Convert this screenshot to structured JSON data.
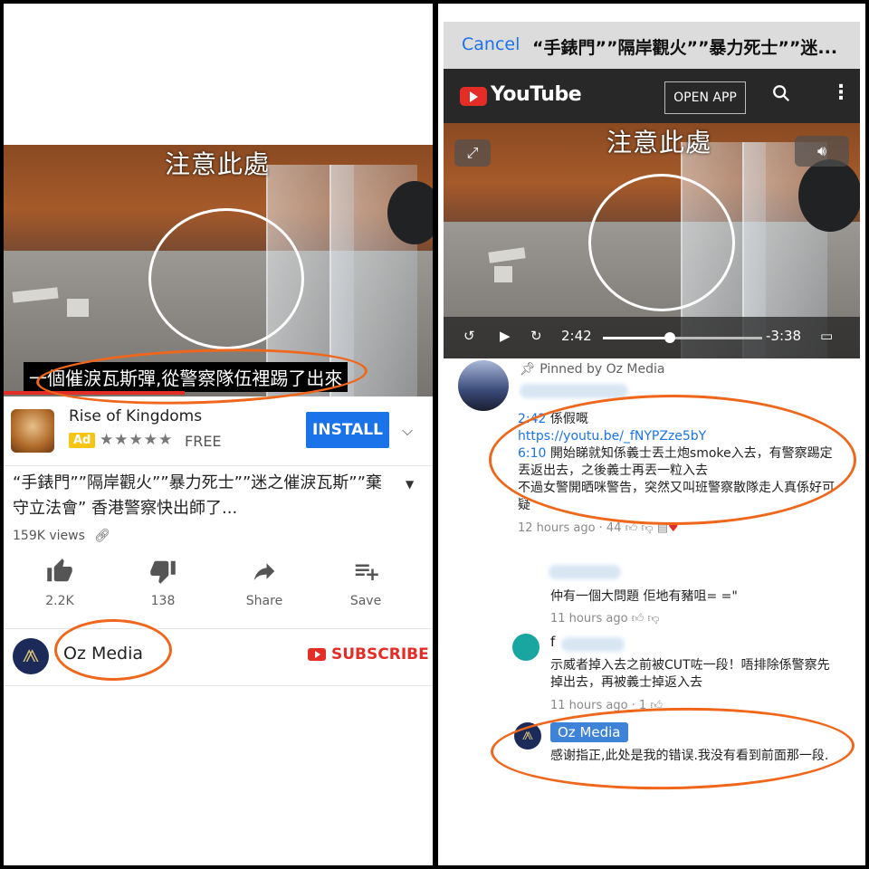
{
  "left": {
    "video": {
      "overlay_caption": "注意此處",
      "subtitle": "一個催淚瓦斯彈,從警察隊伍裡踢了出來"
    },
    "ad": {
      "app_name": "Rise of Kingdoms",
      "badge": "Ad",
      "stars": "★★★★★",
      "price": "FREE",
      "install_label": "INSTALL"
    },
    "video_title": "“手錶門””隔岸觀火””暴力死士””迷之催淚瓦斯””棄守立法會” 香港警察快出師了...",
    "views": "159K views",
    "actions": [
      {
        "icon": "thumbs-up-icon",
        "label": "2.2K"
      },
      {
        "icon": "thumbs-down-icon",
        "label": "138"
      },
      {
        "icon": "share-icon",
        "label": "Share"
      },
      {
        "icon": "playlist-add-icon",
        "label": "Save"
      }
    ],
    "channel": {
      "name": "Oz Media",
      "subscribe_label": "SUBSCRIBE"
    }
  },
  "right": {
    "nav": {
      "cancel_label": "Cancel",
      "title": "“手錶門””隔岸觀火””暴力死士””迷..."
    },
    "youtube_bar": {
      "logo_text": "YouTube",
      "open_app_label": "OPEN APP"
    },
    "video": {
      "overlay_caption": "注意此處",
      "current_time": "2:42",
      "remaining_time": "-3:38",
      "progress": 0.42
    },
    "comments": {
      "pinned_label": "Pinned by Oz Media",
      "first": {
        "line1_time": "2:42",
        "line1_text": " 係假嘅",
        "link": "https://youtu.be/_fNYPZze5bY",
        "line3_time": "6:10",
        "line3_text": " 開始睇就知係義士丟土炮smoke入去，有警察踢定丟返出去，之後義士再丟一粒入去",
        "line4": "不過女警開晒咪警告，突然又叫班警察散隊走人真係好可疑",
        "meta": "12 hours ago · 44"
      },
      "reply1": {
        "text": "仲有一個大問題 佢地有豬咀= =\"",
        "meta": "11 hours ago"
      },
      "reply2": {
        "author_initial": "f",
        "text": "示威者掉入去之前被CUT咗一段！唔排除係警察先掉出去，再被義士掉返入去",
        "meta": "11 hours ago · 1"
      },
      "reply3": {
        "author": "Oz Media",
        "text": "感谢指正,此处是我的错误.我没有看到前面那一段."
      }
    }
  },
  "colors": {
    "accent_blue": "#1a73e8",
    "youtube_red": "#e52d27",
    "annotation_orange": "#f0661a"
  }
}
